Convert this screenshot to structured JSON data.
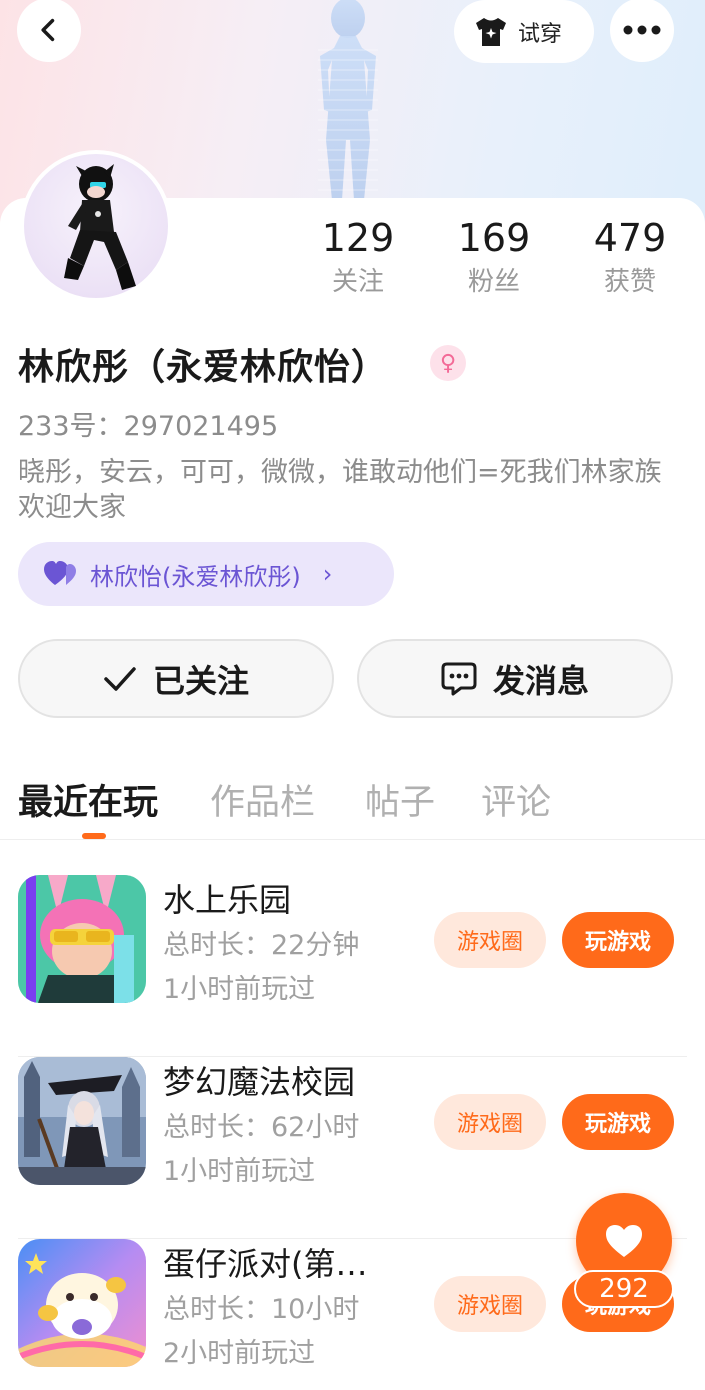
{
  "header": {
    "back_icon": "chevron-left-icon",
    "try_on": {
      "icon": "tshirt-icon",
      "label": "试穿"
    },
    "more_icon": "more-dots-icon"
  },
  "profile": {
    "stats": [
      {
        "value": "129",
        "label": "关注"
      },
      {
        "value": "169",
        "label": "粉丝"
      },
      {
        "value": "479",
        "label": "获赞"
      }
    ],
    "name": "林欣彤（永爱林欣怡）",
    "gender_icon": "female-icon",
    "uid": "233号：297021495",
    "bio": "晓彤，安云，可可，微微，谁敢动他们=死我们林家族欢迎大家",
    "relation": {
      "icon": "double-heart-icon",
      "label": "林欣怡(永爱林欣彤)"
    }
  },
  "actions": {
    "follow_label": "已关注",
    "message_label": "发消息"
  },
  "tabs": [
    "最近在玩",
    "作品栏",
    "帖子",
    "评论"
  ],
  "games": [
    {
      "title": "水上乐园",
      "duration": "总时长：22分钟",
      "last_played": "1小时前玩过",
      "circle_label": "游戏圈",
      "play_label": "玩游戏"
    },
    {
      "title": "梦幻魔法校园",
      "duration": "总时长：62小时",
      "last_played": "1小时前玩过",
      "circle_label": "游戏圈",
      "play_label": "玩游戏"
    },
    {
      "title": "蛋仔派对(第…",
      "duration": "总时长：10小时",
      "last_played": "2小时前玩过",
      "circle_label": "游戏圈",
      "play_label": "玩游戏"
    }
  ],
  "like_fab": {
    "icon": "heart-icon",
    "count": "292"
  },
  "colors": {
    "accent": "#ff6a1a",
    "accent_light": "#ffe8dc",
    "relation_bg": "#ebe6fb",
    "relation_text": "#6b55d4"
  }
}
